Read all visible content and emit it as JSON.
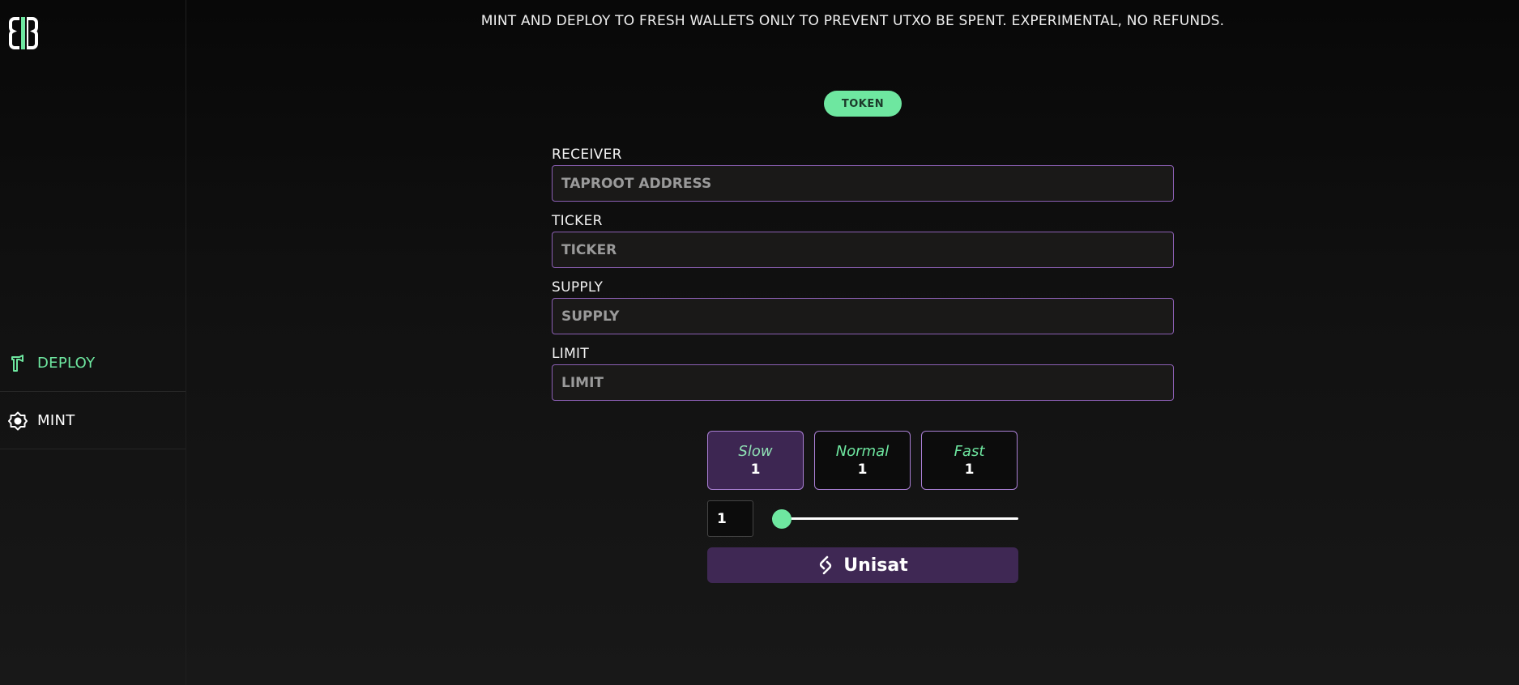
{
  "sidebar": {
    "logo": "eb-logo",
    "items": [
      {
        "label": "DEPLOY",
        "icon": "hammer-icon",
        "active": true
      },
      {
        "label": "MINT",
        "icon": "gear-icon",
        "active": false
      }
    ]
  },
  "notice": "MINT AND DEPLOY TO FRESH WALLETS ONLY TO PREVENT UTXO BE SPENT. EXPERIMENTAL, NO REFUNDS.",
  "mode_pill": "TOKEN",
  "form": {
    "receiver": {
      "label": "RECEIVER",
      "placeholder": "TAPROOT ADDRESS",
      "value": ""
    },
    "ticker": {
      "label": "TICKER",
      "placeholder": "TICKER",
      "value": ""
    },
    "supply": {
      "label": "SUPPLY",
      "placeholder": "SUPPLY",
      "value": ""
    },
    "limit": {
      "label": "LIMIT",
      "placeholder": "LIMIT",
      "value": ""
    }
  },
  "fees": {
    "options": [
      {
        "name": "Slow",
        "value": "1",
        "selected": true
      },
      {
        "name": "Normal",
        "value": "1",
        "selected": false
      },
      {
        "name": "Fast",
        "value": "1",
        "selected": false
      }
    ],
    "custom_rate": "1",
    "slider_fraction": 0
  },
  "submit": {
    "label": "Unisat",
    "icon": "unisat-icon"
  },
  "colors": {
    "accent_green": "#6ee7a0",
    "accent_purple": "#8b5fb3",
    "selected_purple": "#3d2652",
    "button_purple": "#3f2854"
  }
}
